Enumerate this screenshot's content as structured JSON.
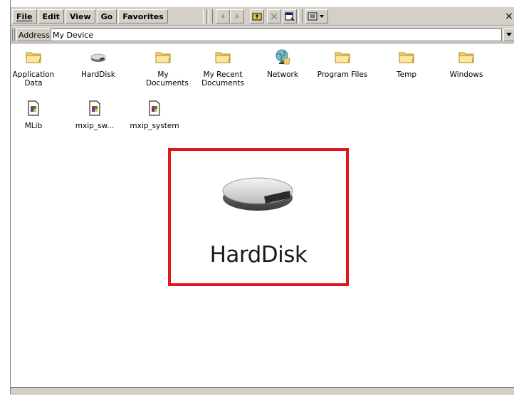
{
  "menu": [
    "File",
    "Edit",
    "View",
    "Go",
    "Favorites"
  ],
  "toolbar": {
    "buttons": [
      "back-icon",
      "forward-icon",
      "up-folder-icon",
      "delete-icon",
      "properties-icon",
      "views-icon"
    ],
    "close_label": "×"
  },
  "address": {
    "label": "Address",
    "value": "My Device"
  },
  "files": [
    {
      "name": "Application Data",
      "icon": "folder-icon"
    },
    {
      "name": "HardDisk",
      "icon": "harddisk-icon"
    },
    {
      "name": "My Documents",
      "icon": "folder-icon"
    },
    {
      "name": "My Recent Documents",
      "icon": "folder-icon"
    },
    {
      "name": "Network",
      "icon": "network-icon"
    },
    {
      "name": "Program Files",
      "icon": "folder-icon"
    },
    {
      "name": "Temp",
      "icon": "folder-icon"
    },
    {
      "name": "Windows",
      "icon": "folder-icon"
    },
    {
      "name": "MLib",
      "icon": "executable-icon"
    },
    {
      "name": "mxip_sw...",
      "icon": "executable-icon"
    },
    {
      "name": "mxip_system",
      "icon": "executable-icon"
    }
  ],
  "callout": {
    "label": "HardDisk",
    "icon": "harddisk-icon",
    "highlight_color": "#e0161b"
  }
}
